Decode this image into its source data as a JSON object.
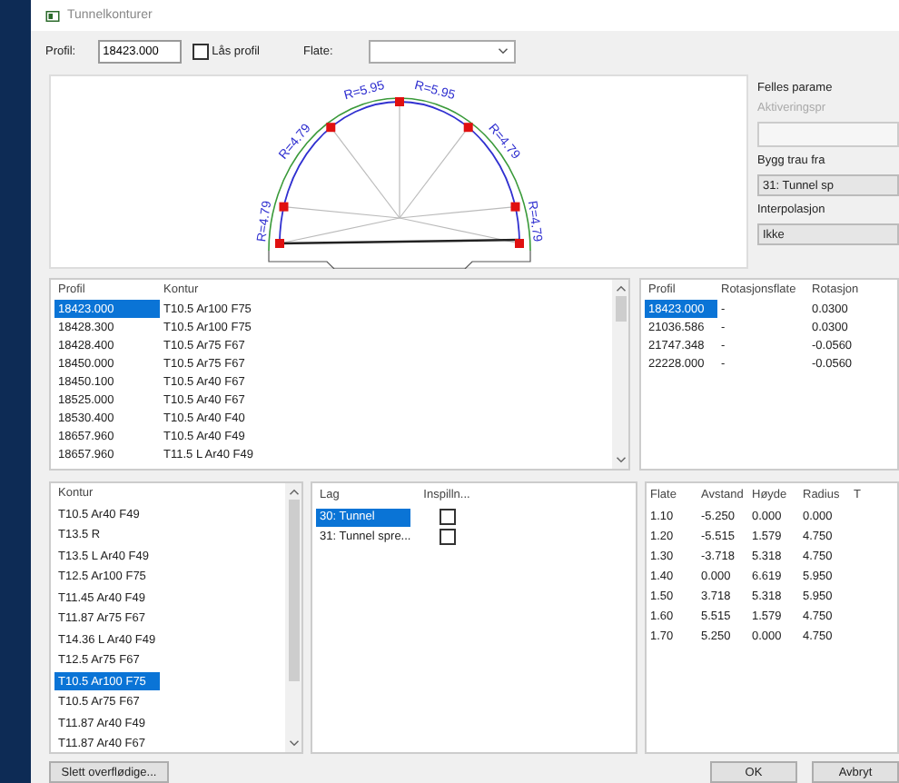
{
  "window": {
    "title": "Tunnelkonturer"
  },
  "toolbar": {
    "profil_label": "Profil:",
    "profil_value": "18423.000",
    "lock": {
      "label": "Lås profil",
      "checked": false
    },
    "flate_label": "Flate:"
  },
  "drawing": {
    "radius_labels": [
      "R=4.79",
      "R=4.79",
      "R=5.95",
      "R=5.95",
      "R=4.79",
      "R=4.79"
    ]
  },
  "side_panel": {
    "title": "Felles parame",
    "faded_label": "Aktiveringspr",
    "build_label": "Bygg trau fra",
    "build_value": "31: Tunnel sp",
    "interp_label": "Interpolasjon",
    "interp_value": "Ikke"
  },
  "profile_table": {
    "columns": [
      "Profil",
      "Kontur"
    ],
    "rows": [
      {
        "cells": [
          "18423.000",
          "T10.5 Ar100 F75"
        ],
        "selected": true
      },
      {
        "cells": [
          "18428.300",
          "T10.5 Ar100 F75"
        ],
        "selected": false
      },
      {
        "cells": [
          "18428.400",
          "T10.5 Ar75 F67"
        ],
        "selected": false
      },
      {
        "cells": [
          "18450.000",
          "T10.5 Ar75 F67"
        ],
        "selected": false
      },
      {
        "cells": [
          "18450.100",
          "T10.5 Ar40 F67"
        ],
        "selected": false
      },
      {
        "cells": [
          "18525.000",
          "T10.5 Ar40 F67"
        ],
        "selected": false
      },
      {
        "cells": [
          "18530.400",
          "T10.5 Ar40 F40"
        ],
        "selected": false
      },
      {
        "cells": [
          "18657.960",
          "T10.5 Ar40 F49"
        ],
        "selected": false
      },
      {
        "cells": [
          "18657.960",
          "T11.5 L Ar40 F49"
        ],
        "selected": false
      }
    ]
  },
  "rotation_table": {
    "columns": [
      "Profil",
      "Rotasjonsflate",
      "Rotasjon"
    ],
    "rows": [
      {
        "cells": [
          "18423.000",
          "-",
          "0.0300"
        ],
        "selected": true
      },
      {
        "cells": [
          "21036.586",
          "-",
          "0.0300"
        ],
        "selected": false
      },
      {
        "cells": [
          "21747.348",
          "-",
          "-0.0560"
        ],
        "selected": false
      },
      {
        "cells": [
          "22228.000",
          "-",
          "-0.0560"
        ],
        "selected": false
      }
    ]
  },
  "kontur_list": {
    "heading": "Kontur",
    "items": [
      {
        "label": "T10.5 Ar40 F49",
        "selected": false
      },
      {
        "label": "T13.5 R",
        "selected": false
      },
      {
        "label": "T13.5 L Ar40 F49",
        "selected": false
      },
      {
        "label": "T12.5 Ar100 F75",
        "selected": false
      },
      {
        "label": "T11.45 Ar40 F49",
        "selected": false
      },
      {
        "label": "T11.87 Ar75 F67",
        "selected": false
      },
      {
        "label": "T14.36 L Ar40 F49",
        "selected": false
      },
      {
        "label": "T12.5 Ar75 F67",
        "selected": false
      },
      {
        "label": "T10.5 Ar100 F75",
        "selected": true
      },
      {
        "label": "T10.5 Ar75 F67",
        "selected": false
      },
      {
        "label": "T11.87 Ar40 F49",
        "selected": false
      },
      {
        "label": "T11.87 Ar40 F67",
        "selected": false
      }
    ]
  },
  "layer_table": {
    "columns": [
      "Lag",
      "Inspilln..."
    ],
    "rows": [
      {
        "label": "30: Tunnel",
        "selected": true,
        "checked": false
      },
      {
        "label": "31: Tunnel spre...",
        "selected": false,
        "checked": false
      }
    ]
  },
  "surface_table": {
    "columns": [
      "Flate",
      "Avstand",
      "Høyde",
      "Radius",
      "T"
    ],
    "rows": [
      [
        "1.10",
        "-5.250",
        "0.000",
        "0.000"
      ],
      [
        "1.20",
        "-5.515",
        "1.579",
        "4.750"
      ],
      [
        "1.30",
        "-3.718",
        "5.318",
        "4.750"
      ],
      [
        "1.40",
        "0.000",
        "6.619",
        "5.950"
      ],
      [
        "1.50",
        "3.718",
        "5.318",
        "5.950"
      ],
      [
        "1.60",
        "5.515",
        "1.579",
        "4.750"
      ],
      [
        "1.70",
        "5.250",
        "0.000",
        "4.750"
      ]
    ]
  },
  "buttons": {
    "delete": "Slett overflødige...",
    "ok": "OK",
    "cancel": "Avbryt"
  }
}
